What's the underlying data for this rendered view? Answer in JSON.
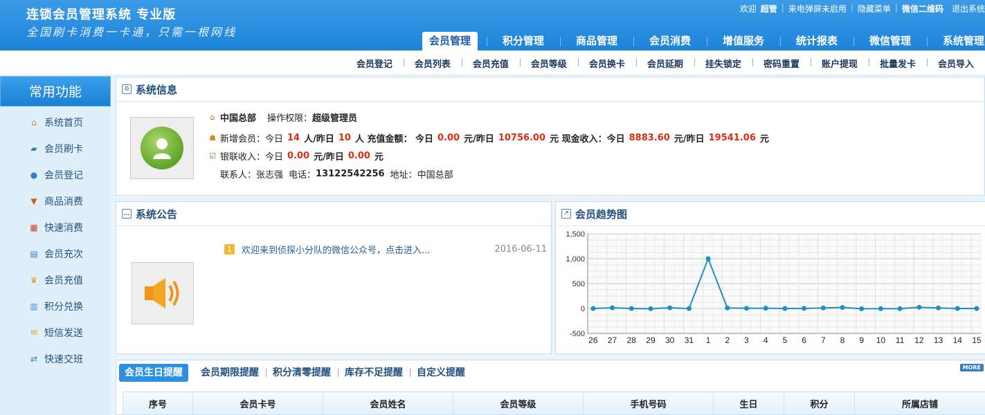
{
  "header": {
    "brand": "连锁会员管理系统 专业版",
    "slogan": "全国刷卡消费一卡通，只需一根网线",
    "toplinks": {
      "welcome": "欢迎",
      "user": "超管",
      "popup": "来电弹屏未启用",
      "hide_menu": "隐藏菜单",
      "wechat_qr": "微信二维码",
      "logout": "退出系统"
    },
    "tabs": [
      "会员管理",
      "积分管理",
      "商品管理",
      "会员消费",
      "增值服务",
      "统计报表",
      "微信管理",
      "系统管理"
    ]
  },
  "subnav": [
    "会员登记",
    "会员列表",
    "会员充值",
    "会员等级",
    "会员换卡",
    "会员延期",
    "挂失锁定",
    "密码重置",
    "账户提现",
    "批量发卡",
    "会员导入"
  ],
  "sidebar": {
    "title": "常用功能",
    "items": [
      {
        "label": "系统首页",
        "icon": "home-icon"
      },
      {
        "label": "会员刷卡",
        "icon": "user-card-icon"
      },
      {
        "label": "会员登记",
        "icon": "users-icon"
      },
      {
        "label": "商品消费",
        "icon": "cart-icon"
      },
      {
        "label": "快速消费",
        "icon": "chart-icon"
      },
      {
        "label": "会员充次",
        "icon": "cup-icon"
      },
      {
        "label": "会员充值",
        "icon": "crown-icon"
      },
      {
        "label": "积分兑换",
        "icon": "gift-icon"
      },
      {
        "label": "短信发送",
        "icon": "mail-icon"
      },
      {
        "label": "快速交班",
        "icon": "handover-icon"
      }
    ]
  },
  "sysinfo": {
    "title": "系统信息",
    "store": "中国总部",
    "perm_label": "操作权限：",
    "perm_value": "超级管理员",
    "new_members_label": "新增会员：今日",
    "today_new": "14",
    "yesterday_label": "人/昨日",
    "yesterday_new": "10",
    "recharge_label": "人 充值金额： 今日",
    "today_recharge": "0.00",
    "yuan_yesterday": "元/昨日",
    "yesterday_recharge": "10756.00",
    "cash_label": "元 现金收入：今日",
    "today_cash": "8883.60",
    "yesterday_cash": "19541.06",
    "yuan": "元",
    "unionpay_label": "银联收入：今日",
    "today_unionpay": "0.00",
    "yesterday_unionpay": "0.00",
    "contact_label": "联系人：",
    "contact": "张志强",
    "phone_label": "电话：",
    "phone": "13122542256",
    "address_label": "地址：",
    "address": "中国总部"
  },
  "notice": {
    "title": "系统公告",
    "items": [
      {
        "num": "1",
        "text": "欢迎来到侦探小分队的微信公众号，点击进入...",
        "date": "2016-06-11"
      }
    ]
  },
  "trend": {
    "title": "会员趋势图"
  },
  "chart_data": {
    "type": "line",
    "title": "会员趋势图",
    "x": [
      "26",
      "27",
      "28",
      "29",
      "30",
      "31",
      "1",
      "2",
      "3",
      "4",
      "5",
      "6",
      "7",
      "8",
      "9",
      "10",
      "11",
      "12",
      "13",
      "14",
      "15"
    ],
    "series": [
      {
        "values": [
          0,
          14,
          0,
          -5,
          14,
          -2,
          1000,
          10,
          4,
          5,
          0,
          2,
          10,
          20,
          -5,
          -3,
          -4,
          25,
          10,
          0,
          0
        ]
      }
    ],
    "ylim": [
      -500,
      1500
    ],
    "yticks": [
      -500,
      0,
      500,
      1000,
      1500
    ],
    "ytick_labels": [
      "-500",
      "0",
      "500",
      "1,000",
      "1,500"
    ],
    "grid": true,
    "color": "#1c8fc7"
  },
  "reminders": {
    "tabs": [
      "会员生日提醒",
      "会员期限提醒",
      "积分清零提醒",
      "库存不足提醒",
      "自定义提醒"
    ],
    "more": "MORE",
    "columns": [
      "序号",
      "会员卡号",
      "会员姓名",
      "会员等级",
      "手机号码",
      "生日",
      "积分",
      "所属店铺"
    ]
  }
}
